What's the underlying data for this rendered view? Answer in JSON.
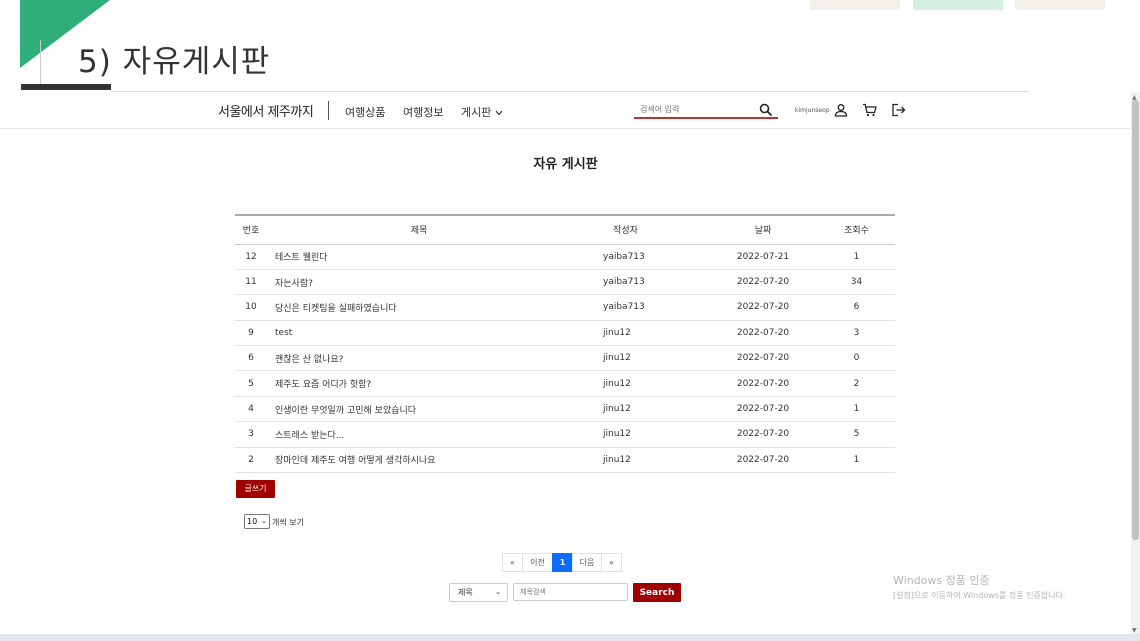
{
  "slide": {
    "title": "5) 자유게시판"
  },
  "header": {
    "logo": "서울에서 제주까지",
    "nav": [
      "여행상품",
      "여행정보",
      "게시판"
    ],
    "nav_dropdown_arrow": "⌄",
    "search_placeholder": "검색어 입력",
    "username": "kimjunseop"
  },
  "board": {
    "title": "자유 게시판",
    "columns": [
      "번호",
      "제목",
      "작성자",
      "날짜",
      "조회수"
    ],
    "rows": [
      {
        "no": "12",
        "title": "테스트 웰린다",
        "author": "yaiba713",
        "date": "2022-07-21",
        "views": "1"
      },
      {
        "no": "11",
        "title": "자는사람?",
        "author": "yaiba713",
        "date": "2022-07-20",
        "views": "34"
      },
      {
        "no": "10",
        "title": "당신은 티켓팅을 실패하였습니다",
        "author": "yaiba713",
        "date": "2022-07-20",
        "views": "6"
      },
      {
        "no": "9",
        "title": "test",
        "author": "jinu12",
        "date": "2022-07-20",
        "views": "3"
      },
      {
        "no": "6",
        "title": "괜찮은 산 없나요?",
        "author": "jinu12",
        "date": "2022-07-20",
        "views": "0"
      },
      {
        "no": "5",
        "title": "제주도 요즘 어디가 핫함?",
        "author": "jinu12",
        "date": "2022-07-20",
        "views": "2"
      },
      {
        "no": "4",
        "title": "인생이란 무엇일까 고민해 보았습니다",
        "author": "jinu12",
        "date": "2022-07-20",
        "views": "1"
      },
      {
        "no": "3",
        "title": "스트레스 받는다...",
        "author": "jinu12",
        "date": "2022-07-20",
        "views": "5"
      },
      {
        "no": "2",
        "title": "장마인데 제주도 여행 어떻게 생각하시나요",
        "author": "jinu12",
        "date": "2022-07-20",
        "views": "1"
      }
    ],
    "write_button": "글쓰기",
    "per_page_value": "10",
    "per_page_label": "개씩 보기"
  },
  "pagination": {
    "first": "«",
    "prev": "이전",
    "current": "1",
    "next": "다음",
    "last": "»"
  },
  "search_form": {
    "field_value": "제목",
    "keyword_placeholder": "제목검색",
    "button": "Search"
  },
  "watermark": {
    "line1": "Windows 정품 인증",
    "line2": "[설정]으로 이동하여 Windows를 정품 인증합니다."
  },
  "colors": {
    "accent_green": "#2fae79",
    "button_red": "#a00000",
    "page_active": "#0d6efd"
  },
  "icons": [
    "search-icon",
    "user-icon",
    "cart-icon",
    "logout-icon",
    "chevron-down-icon"
  ]
}
